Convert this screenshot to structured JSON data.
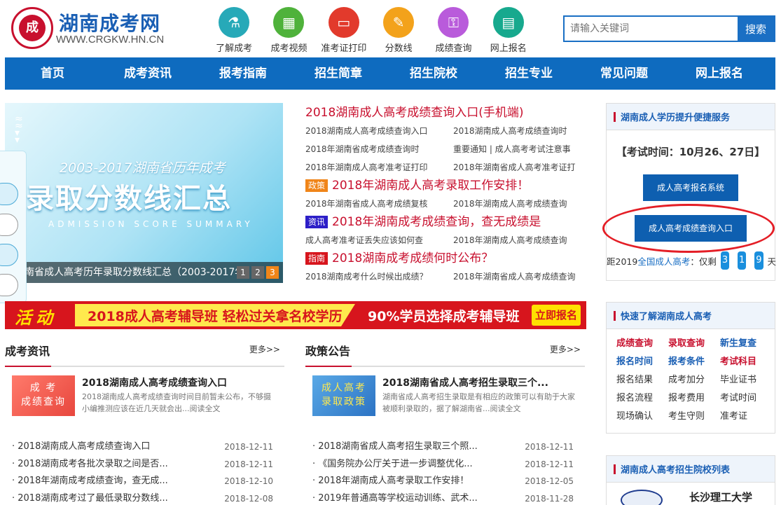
{
  "header": {
    "logo_badge": "成",
    "site_title": "湖南成考网",
    "site_url": "WWW.CRGKW.HN.CN",
    "quick_icons": [
      {
        "label": "了解成考",
        "icon": "flask-icon",
        "color": "#27a9b8"
      },
      {
        "label": "成考视频",
        "icon": "building-icon",
        "color": "#4fb23b"
      },
      {
        "label": "准考证打印",
        "icon": "monitor-icon",
        "color": "#e23a2c"
      },
      {
        "label": "分数线",
        "icon": "pencil-icon",
        "color": "#f3a21b"
      },
      {
        "label": "成绩查询",
        "icon": "key-icon",
        "color": "#b95bdb"
      },
      {
        "label": "网上报名",
        "icon": "clipboard-icon",
        "color": "#17a98e"
      }
    ],
    "search_placeholder": "请输入关键词",
    "search_button": "搜索"
  },
  "nav": [
    "首页",
    "成考资讯",
    "报考指南",
    "招生简章",
    "招生院校",
    "招生专业",
    "常见问题",
    "网上报名"
  ],
  "banner": {
    "line1": "2003-2017湖南省历年成考",
    "line2": "录取分数线汇总",
    "line3": "ADMISSION  SCORE  SUMMARY",
    "caption": "南省成人高考历年录取分数线汇总（2003-2017年",
    "pages": [
      "1",
      "2",
      "3"
    ]
  },
  "news": {
    "headline1": "2018湖南成人高考成绩查询入口(手机端)",
    "rows1": [
      [
        "2018湖南成人高考成绩查询入口",
        "2018湖南成人高考成绩查询时"
      ],
      [
        "2018年湖南省成考成绩查询时",
        "重要通知 | 成人高考考试注意事"
      ],
      [
        "2018年湖南成人高考准考证打印",
        "2018年湖南省成人高考准考证打"
      ]
    ],
    "tag2": "政策",
    "headline2": "2018年湖南成人高考录取工作安排！",
    "rows2": [
      [
        "2018年湖南省成人高考成绩复核",
        "2018年湖南成人高考成绩查询"
      ]
    ],
    "tag3": "资讯",
    "headline3": "2018年湖南成考成绩查询，查无成绩是",
    "rows3": [
      [
        "成人高考准考证丢失应该如何查",
        "2018年湖南成人高考成绩查询"
      ]
    ],
    "tag4": "指南",
    "headline4": "2018湖南成考成绩何时公布？",
    "rows4": [
      [
        "2018湖南成考什么时候出成绩？",
        "2018年湖南省成人高考成绩查询"
      ]
    ]
  },
  "promo": {
    "activity": "活动",
    "main": "2018成人高考辅导班 轻松过关拿名校学历",
    "right": "90%学员选择成考辅导班",
    "button": "立即报名"
  },
  "col_news": {
    "title": "成考资讯",
    "more": "更多>>",
    "thumb": "成 考\n成绩查询",
    "featured_title": "2018湖南成人高考成绩查询入口",
    "featured_desc": "2018湖南成人高考成绩查询时间目前暂未公布，不够摄小编推测应该在近几天就会出...阅读全文",
    "items": [
      {
        "t": "· 2018湖南成人高考成绩查询入口",
        "d": "2018-12-11"
      },
      {
        "t": "· 2018湖南成考各批次录取之间是否...",
        "d": "2018-12-11"
      },
      {
        "t": "· 2018年湖南成考成绩查询，查无成...",
        "d": "2018-12-10"
      },
      {
        "t": "· 2018湖南成考过了最低录取分数线...",
        "d": "2018-12-08"
      }
    ]
  },
  "col_policy": {
    "title": "政策公告",
    "more": "更多>>",
    "thumb": "成人高考\n录取政策",
    "featured_title": "2018湖南省成人高考招生录取三个...",
    "featured_desc": "湖南省成人高考招生录取是有相应的政策可以有助于大家被顺利录取的，据了解湖南省...阅读全文",
    "items": [
      {
        "t": "· 2018湖南省成人高考招生录取三个照...",
        "d": "2018-12-11"
      },
      {
        "t": "· 《国务院办公厅关于进一步调整优化...",
        "d": "2018-12-11"
      },
      {
        "t": "· 2018年湖南成人高考录取工作安排！",
        "d": "2018-12-05"
      },
      {
        "t": "· 2019年普通高等学校运动训练、武术...",
        "d": "2018-11-28"
      }
    ]
  },
  "side1": {
    "title": "湖南成人学历提升便捷服务",
    "exam_time": "【考试时间：10月26、27日】",
    "btn1": "成人高考报名系统",
    "btn2": "成人高考成绩查询入口",
    "cd_prefix": "距2019",
    "cd_highlight": "全国成人高考",
    "cd_mid": "：仅剩",
    "cd_digits": [
      "3",
      "1",
      "9"
    ],
    "cd_suffix": "天"
  },
  "side2": {
    "title": "快速了解湖南成人高考",
    "links": [
      {
        "t": "成绩查询",
        "s": "r"
      },
      {
        "t": "录取查询",
        "s": "r"
      },
      {
        "t": "新生复查",
        "s": "b"
      },
      {
        "t": "报名时间",
        "s": "b"
      },
      {
        "t": "报考条件",
        "s": "b"
      },
      {
        "t": "考试科目",
        "s": "r"
      },
      {
        "t": "报名结果",
        "s": ""
      },
      {
        "t": "成考加分",
        "s": ""
      },
      {
        "t": "毕业证书",
        "s": ""
      },
      {
        "t": "报名流程",
        "s": ""
      },
      {
        "t": "报考费用",
        "s": ""
      },
      {
        "t": "考试时间",
        "s": ""
      },
      {
        "t": "现场确认",
        "s": ""
      },
      {
        "t": "考生守则",
        "s": ""
      },
      {
        "t": "准考证",
        "s": ""
      }
    ]
  },
  "side3": {
    "title": "湖南成人高考招生院校列表",
    "school": "长沙理工大学"
  }
}
